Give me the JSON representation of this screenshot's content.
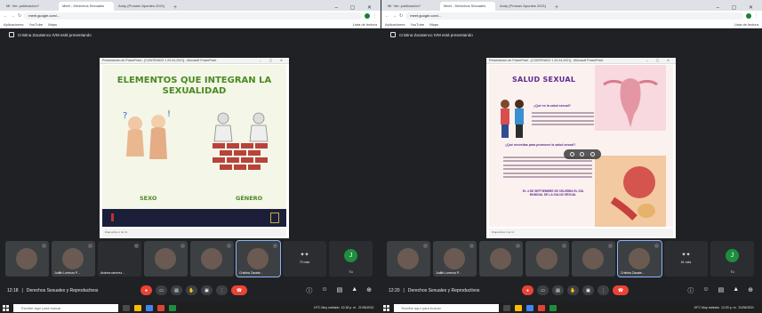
{
  "browser": {
    "tabs": [
      "Mi. Ver: publicación?",
      "Meet - Derechos Sexuales",
      "Andy (Prosser Apuntes 2021)"
    ],
    "url": "meet.google.com/...",
    "bookmarks": [
      "Aplicaciones",
      "YouTube",
      "Maps"
    ],
    "reading_list": "Lista de lectura"
  },
  "panes": [
    {
      "presenter": "Cristina Zacatenco IVM está presentando",
      "ppt_window_title": "Presentación de PowerPoint - [CONTENIDO 1 20-04-2021] - Microsoft PowerPoint",
      "slide_title": "ELEMENTOS QUE INTEGRAN LA SEXUALIDAD",
      "labels": [
        "SEXO",
        "GÉNERO"
      ],
      "status": "Diapositiva 1 de 11",
      "tiles": [
        {
          "name": "",
          "type": "person"
        },
        {
          "name": "Judith Lorenzo P...",
          "type": "person"
        },
        {
          "name": "Andrea ramírez...",
          "type": "dark"
        },
        {
          "name": "",
          "type": "person"
        },
        {
          "name": "",
          "type": "person"
        },
        {
          "name": "Cristina Zacate...",
          "type": "person",
          "active": true
        },
        {
          "name": "",
          "type": "more",
          "count": "",
          "label": "79 más"
        },
        {
          "name": "",
          "type": "you",
          "initial": "J",
          "label": "Tú"
        }
      ],
      "meet_time": "12:18",
      "meet_title": "Derechos Sexuales y Reproductivos",
      "taskbar_time": "12:18 p. m.",
      "taskbar_date": "21/06/2021",
      "weather": "19°C  Muy nublado"
    },
    {
      "presenter": "Cristina Zacatenco IVM está presentando",
      "ppt_window_title": "Presentación de PowerPoint - [CONTENIDO 1 20-04-2021] - Microsoft PowerPoint",
      "slide_title": "SALUD SEXUAL",
      "q1": "¿Qué es la salud sexual?",
      "q2": "¿Qué necesitas para promover la salud sexual?",
      "q3": "EL 4 DE SEPTIEMBRE SE CELEBRA EL DÍA MUNDIAL DE LA SALUD SEXUAL",
      "status": "Diapositiva 2 de 11",
      "tiles": [
        {
          "name": "",
          "type": "person"
        },
        {
          "name": "Judith Lorenzo P...",
          "type": "person"
        },
        {
          "name": "",
          "type": "person"
        },
        {
          "name": "",
          "type": "person"
        },
        {
          "name": "",
          "type": "person"
        },
        {
          "name": "Cristina Zacate...",
          "type": "person",
          "active": true
        },
        {
          "name": "",
          "type": "more",
          "label": "81 más"
        },
        {
          "name": "",
          "type": "you",
          "initial": "J",
          "label": "Tú"
        }
      ],
      "meet_time": "12:20",
      "meet_title": "Derechos Sexuales y Reproductivos",
      "taskbar_time": "12:20 p. m.",
      "taskbar_date": "21/06/2021",
      "weather": "19°C  Muy nublado"
    }
  ],
  "taskbar": {
    "search_placeholder": "Escribe aquí para buscar"
  },
  "colors": {
    "accent_green": "#4a8a21",
    "end_call": "#ea4335",
    "meet_bg": "#202124"
  }
}
